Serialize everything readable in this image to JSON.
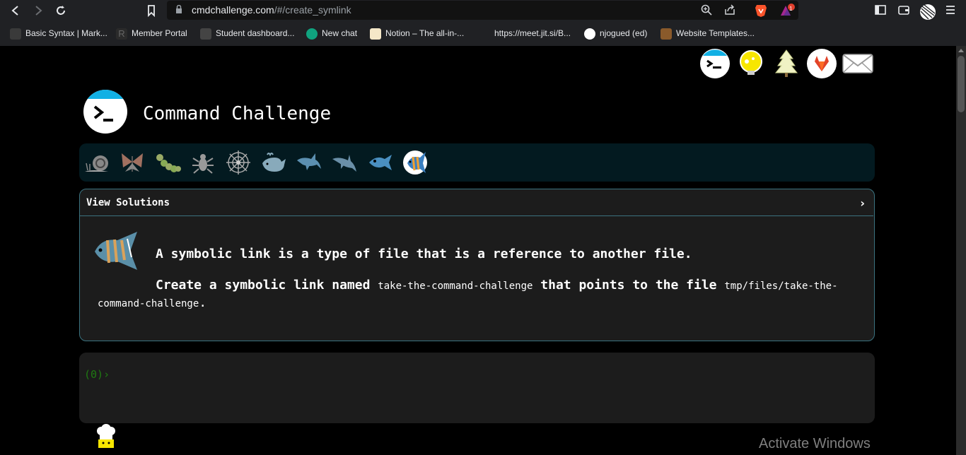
{
  "browser": {
    "url_domain": "cmdchallenge.com",
    "url_path": "/#/create_symlink",
    "bookmarks": [
      {
        "label": "Basic Syntax | Mark..."
      },
      {
        "label": "Member Portal"
      },
      {
        "label": "Student dashboard..."
      },
      {
        "label": "New chat"
      },
      {
        "label": "Notion – The all-in-..."
      },
      {
        "label": "https://meet.jit.si/B..."
      },
      {
        "label": "njogued (ed)"
      },
      {
        "label": "Website Templates..."
      }
    ],
    "notification_count": "1"
  },
  "header": {
    "title": "Command Challenge"
  },
  "panel": {
    "toggle_label": "View Solutions",
    "chevron": "›",
    "description_line1": "A symbolic link is a type of file that is a reference to another file.",
    "task_prefix": "Create a symbolic link named ",
    "task_code1": "take-the-command-challenge",
    "task_middle": " that points to the file ",
    "task_code2": "tmp/files/take-the-command-challenge",
    "task_suffix": "."
  },
  "terminal": {
    "prompt": "(0)›"
  },
  "footer": {
    "partial_text": "_ _ _ _ _ _ _ _ _ _ _"
  },
  "watermark": "Activate Windows",
  "colors": {
    "accent": "#12b0e4",
    "panel_border": "#3b7380",
    "prompt_green": "#1f7a12"
  }
}
